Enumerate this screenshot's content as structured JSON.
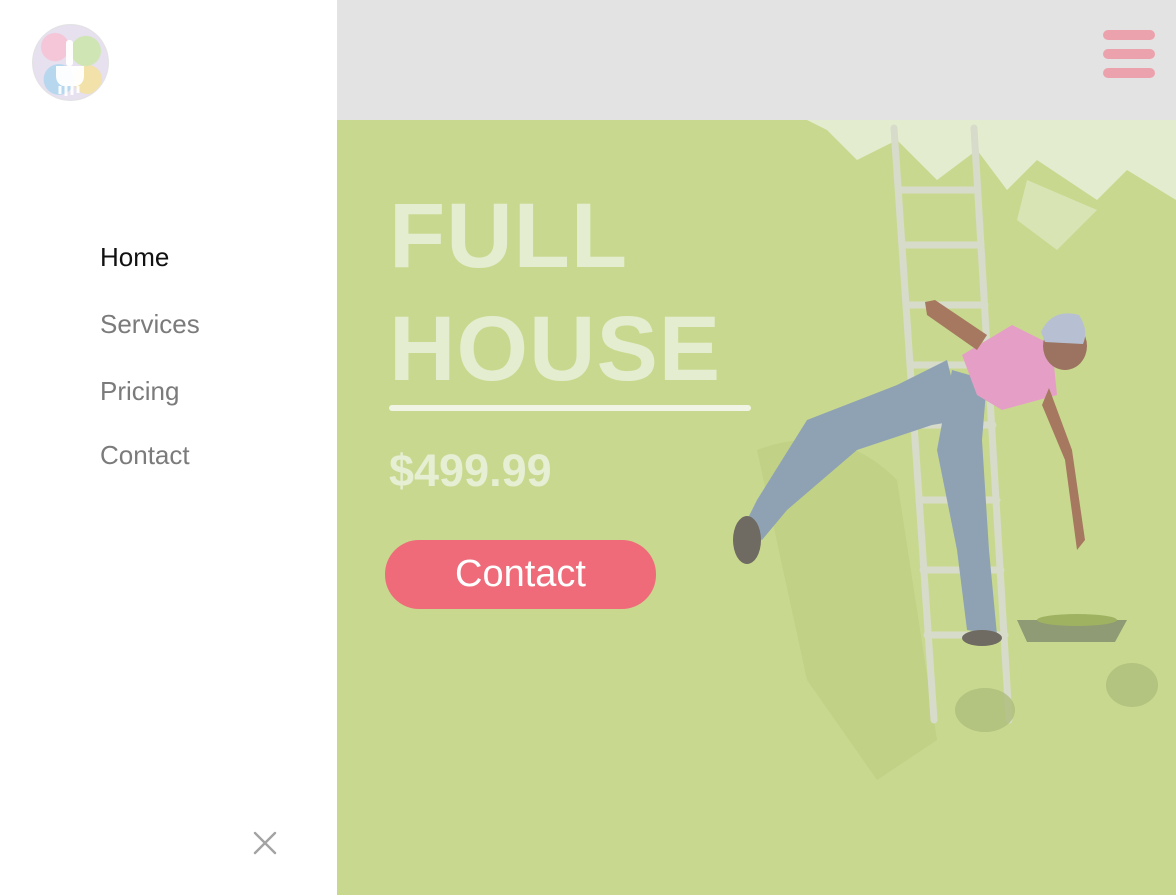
{
  "nav": {
    "items": [
      {
        "label": "Home",
        "active": true
      },
      {
        "label": "Services",
        "active": false
      },
      {
        "label": "Pricing",
        "active": false
      },
      {
        "label": "Contact",
        "active": false
      }
    ],
    "close_icon": "close-icon",
    "logo_icon": "paintbrush-logo"
  },
  "header": {
    "menu_icon": "hamburger-menu-icon"
  },
  "hero": {
    "title_line1": "FULL",
    "title_line2": "HOUSE",
    "price": "$499.99",
    "cta_label": "Contact"
  },
  "colors": {
    "accent": "#ef6b7a",
    "hero_green": "#c8d98f",
    "menu_icon": "#eca2ad"
  }
}
